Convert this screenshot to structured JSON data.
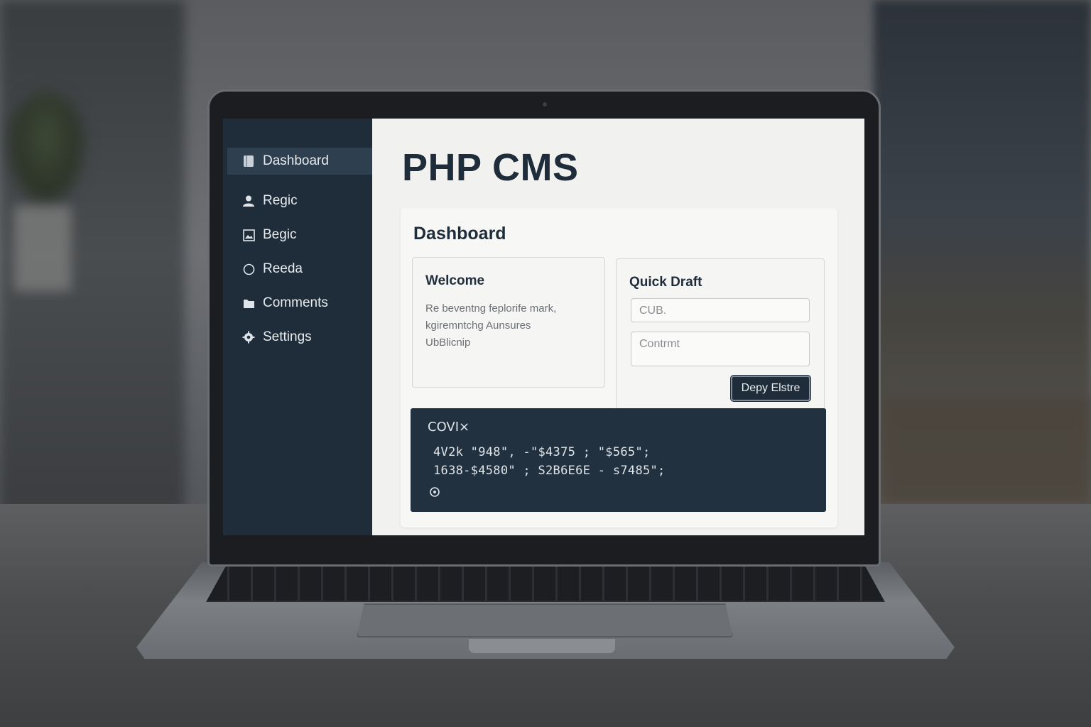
{
  "app": {
    "title": "PHP CMS"
  },
  "sidebar": {
    "items": [
      {
        "label": "Dashboard",
        "icon": "dashboard-icon",
        "active": true
      },
      {
        "label": "Regic",
        "icon": "user-icon"
      },
      {
        "label": "Begic",
        "icon": "image-icon"
      },
      {
        "label": "Reeda",
        "icon": "circle-icon"
      },
      {
        "label": "Comments",
        "icon": "folder-icon"
      },
      {
        "label": "Settings",
        "icon": "gear-icon"
      }
    ]
  },
  "dashboard": {
    "title": "Dashboard",
    "welcome": {
      "title": "Welcome",
      "lines": [
        "Re beventng feplorife mark,",
        "kgiremntchg Aunsures",
        "UbBlicnip"
      ]
    },
    "quick_draft": {
      "title": "Quick Draft",
      "title_placeholder": "CUB.",
      "content_placeholder": "Contrmt",
      "button_label": "Depy Elstre"
    },
    "code": {
      "header": "COVI×",
      "lines": [
        "4V2k \"948\", -\"$4375 ; \"$565\";",
        "1638-$4580\" ; S2B6E6E - s7485\";"
      ],
      "footer_icon": "gear-small-icon"
    }
  },
  "colors": {
    "sidebar_bg": "#1f2d3b",
    "accent": "#1f2d3b",
    "code_bg": "#223140",
    "screen_bg": "#f1f1ef"
  }
}
